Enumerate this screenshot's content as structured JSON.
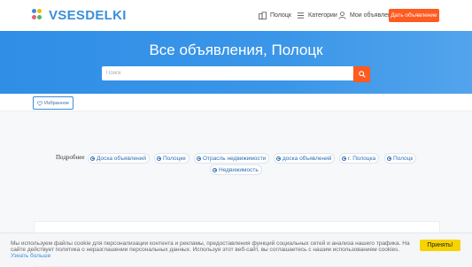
{
  "header": {
    "logo_text": "VSESDELKI",
    "nav": {
      "cities": "Полоцк",
      "categories": "Категории",
      "my_ads": "Мои объявления"
    },
    "post_ad_label": "Дать объявление"
  },
  "hero": {
    "title": "Все объявления, Полоцк",
    "search_placeholder": "Поиск"
  },
  "favorites_label": "Избранное",
  "tags": {
    "label": "Подробнее",
    "items": [
      "Доска объявлений",
      "Полоцке",
      "Отрасль недвижимости",
      "доска объявлений",
      "г. Полоцка",
      "Полоцк",
      "Недвижимость"
    ]
  },
  "cookie": {
    "text": "Мы используем файлы cookie для персонализации контента и рекламы, предоставления функций социальных сетей и анализа нашего трафика. На сайте действует политика о неразглашении персональных данных. Используя этот веб-сайт, вы соглашаетесь с нашим использованием cookies.",
    "learn_more": "Узнать больше",
    "accept_label": "Принять!"
  },
  "colors": {
    "brand_blue": "#3b8fd9",
    "accent_orange": "#ff5a1f",
    "accept_yellow": "#f7d300",
    "logo_dots": [
      "#3b8fd9",
      "#f5b800",
      "#e85d75",
      "#4cb86a"
    ]
  }
}
